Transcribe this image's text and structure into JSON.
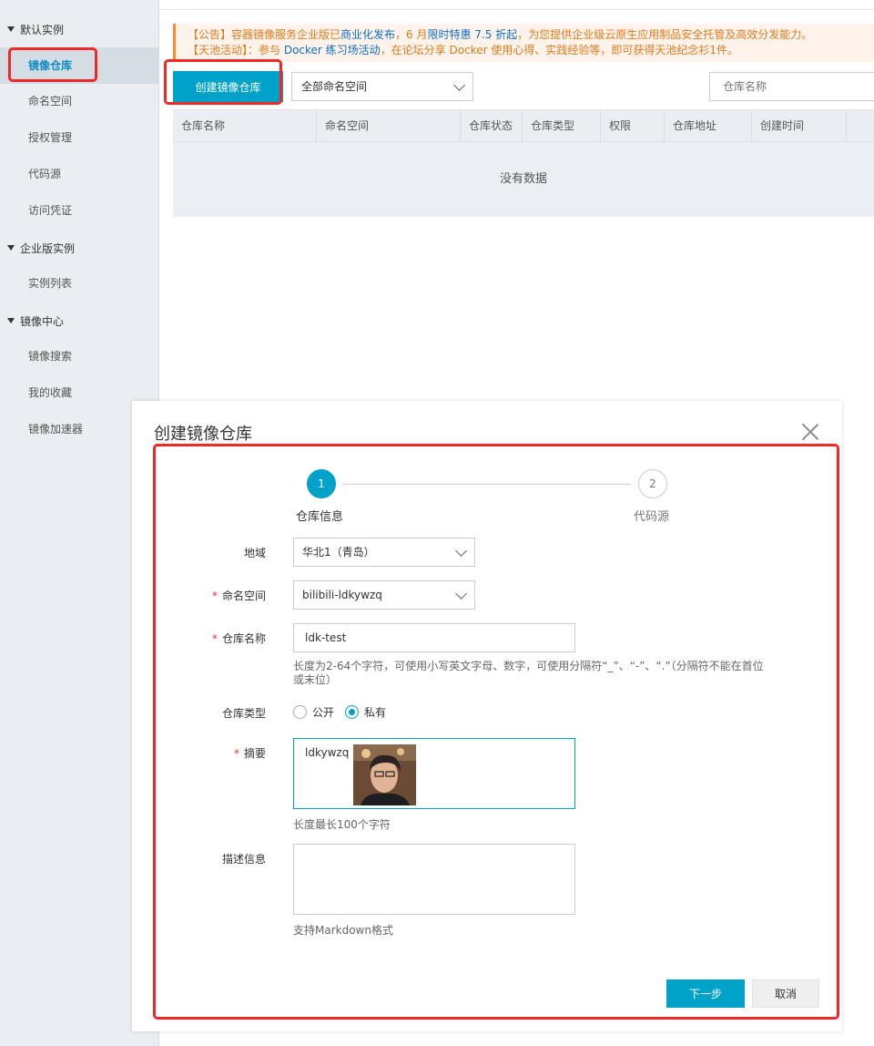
{
  "sidebar": {
    "groups": [
      {
        "label": "默认实例"
      },
      {
        "label": "企业版实例"
      },
      {
        "label": "镜像中心"
      }
    ],
    "items": [
      {
        "label": "镜像仓库"
      },
      {
        "label": "命名空间"
      },
      {
        "label": "授权管理"
      },
      {
        "label": "代码源"
      },
      {
        "label": "访问凭证"
      },
      {
        "label": "实例列表"
      },
      {
        "label": "镜像搜索"
      },
      {
        "label": "我的收藏"
      },
      {
        "label": "镜像加速器"
      }
    ]
  },
  "notice": {
    "line1": {
      "prefix": "【公告】容器镜像服务企业版已",
      "link1": "商业化发布",
      "middle": "，6 月",
      "link2": "限时特惠 7.5 折起",
      "suffix": "，为您提供企业级云原生应用制品安全托管及高效分发能力。"
    },
    "line2": {
      "prefix": "【天池活动】：参与",
      "link": " Docker 练习场活动",
      "suffix": "，在论坛分享 Docker 使用心得、实践经验等，即可获得天池纪念衫1件。"
    }
  },
  "toolbar": {
    "create_label": "创建镜像仓库",
    "namespace_filter": "全部命名空间",
    "search_placeholder": "仓库名称"
  },
  "table": {
    "columns": [
      "仓库名称",
      "命名空间",
      "仓库状态",
      "仓库类型",
      "权限",
      "仓库地址",
      "创建时间"
    ],
    "empty_text": "没有数据"
  },
  "modal": {
    "title": "创建镜像仓库",
    "steps": [
      {
        "number": "1",
        "label": "仓库信息"
      },
      {
        "number": "2",
        "label": "代码源"
      }
    ],
    "form": {
      "region_label": "地域",
      "region_value": "华北1（青岛）",
      "namespace_label": "命名空间",
      "namespace_value": "bilibili-ldkywzq",
      "repo_name_label": "仓库名称",
      "repo_name_value": "ldk-test",
      "repo_name_hint": "长度为2-64个字符，可使用小写英文字母、数字，可使用分隔符“_”、“-”、“.”（分隔符不能在首位或末位）",
      "repo_type_label": "仓库类型",
      "repo_type_options": [
        "公开",
        "私有"
      ],
      "repo_type_selected": "私有",
      "summary_label": "摘要",
      "summary_value": "ldkywzq",
      "summary_hint": "长度最长100个字符",
      "description_label": "描述信息",
      "description_value": "",
      "description_hint": "支持Markdown格式"
    },
    "next_label": "下一步",
    "cancel_label": "取消"
  },
  "colors": {
    "accent": "#00a2ca",
    "highlight_box": "#f02828",
    "notice_text": "#e07b1c",
    "required": "#ee3333"
  }
}
